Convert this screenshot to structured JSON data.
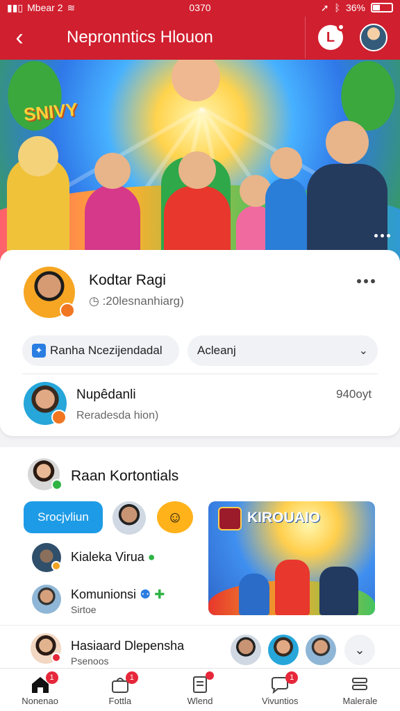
{
  "status_bar": {
    "carrier": "Mbear 2",
    "time": "0370",
    "battery": "36%"
  },
  "header": {
    "title": "Nepronntics Hlouon"
  },
  "hero": {
    "badge_text": "SNIVY"
  },
  "profile_card": {
    "user": {
      "name": "Kodtar Ragi",
      "meta": ":20lesnanhiarg)"
    },
    "pill_left": {
      "label": "Ranha  Ncezijendadal"
    },
    "pill_right": {
      "label": "Acleanj"
    },
    "row": {
      "name": "Nupêdanli",
      "sub": "Reradesda hion)",
      "value": "940oyt"
    }
  },
  "section": {
    "title": "Raan Kortontials",
    "button_label": "Srocjvliun",
    "items": [
      {
        "label": "Kialeka Virua"
      },
      {
        "label": "Komunionsi",
        "sub": "Sirtoe"
      }
    ],
    "thumbnail": {
      "title": "KIROUAIO"
    }
  },
  "row3": {
    "title": "Hasiaard Dlepensha",
    "sub": "Psenoos"
  },
  "bottom_nav": {
    "items": [
      {
        "label": "Nonenao",
        "badge": "1"
      },
      {
        "label": "Fottla",
        "badge": "1"
      },
      {
        "label": "Wlend",
        "badge": ""
      },
      {
        "label": "Vivuntios",
        "badge": "1"
      },
      {
        "label": "Malerale",
        "badge": ""
      }
    ]
  }
}
